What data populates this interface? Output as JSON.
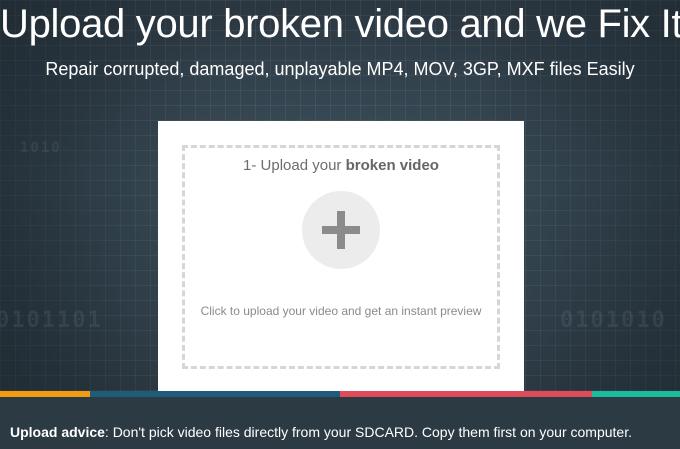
{
  "hero": {
    "headline": "Upload your broken video and we Fix It!",
    "subline": "Repair corrupted, damaged, unplayable MP4, MOV, 3GP, MXF files Easily"
  },
  "upload_box": {
    "step_prefix": "1- Upload your ",
    "step_emphasis": "broken video",
    "plus_icon": "plus-icon",
    "hint": "Click to upload your video and get an instant preview"
  },
  "stripe_colors": [
    "#f39c12",
    "#1f5c7a",
    "#e04b5a",
    "#1abc9c"
  ],
  "footer": {
    "advice_label": "Upload advice",
    "advice_text": ": Don't pick video files directly from your SDCARD. Copy them first on your computer."
  },
  "colors": {
    "background": "#2c3a44",
    "card": "#ffffff",
    "dashed_border": "#d6d6d6",
    "plus_circle": "#ececec"
  }
}
